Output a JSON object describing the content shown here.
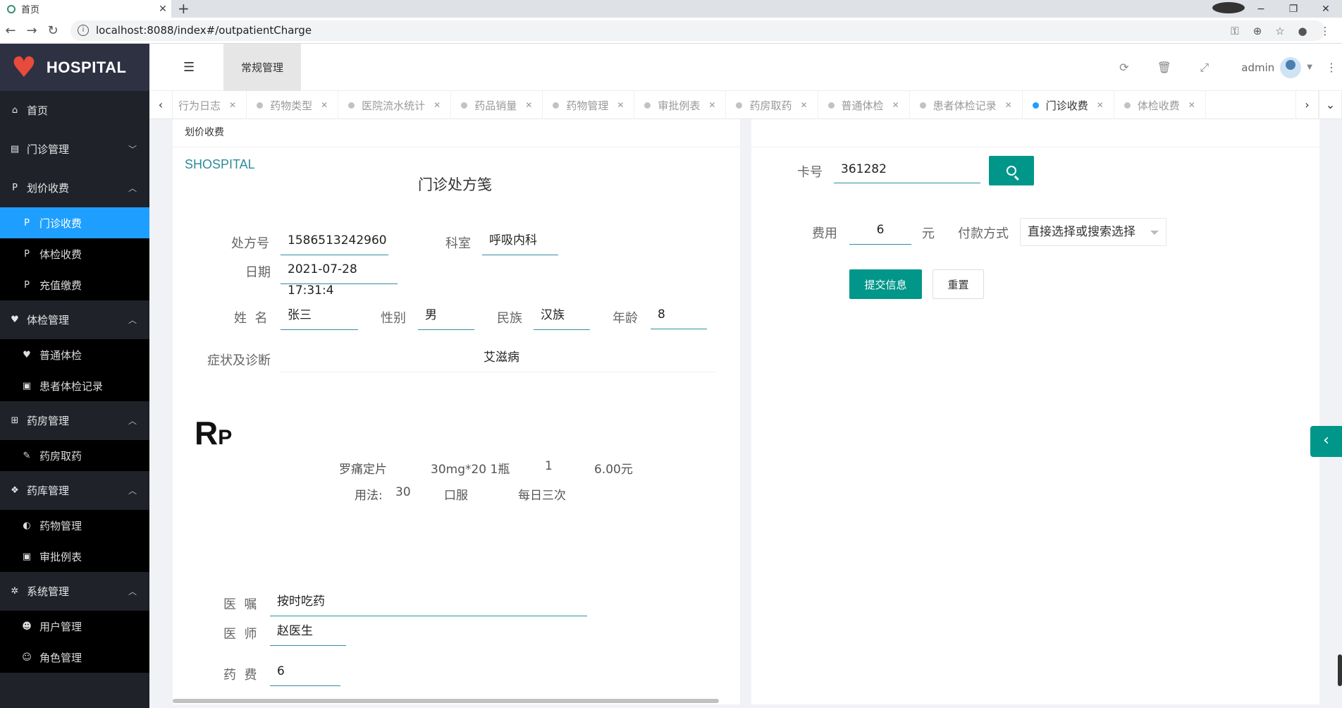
{
  "browser": {
    "tab_title": "首页",
    "tab_close": "✕",
    "new_tab": "+",
    "url": "localhost:8088/index#/outpatientCharge"
  },
  "sidebar": {
    "logo_text": "HOSPITAL",
    "items": [
      {
        "label": "首页"
      },
      {
        "label": "门诊管理"
      },
      {
        "label": "划价收费"
      },
      {
        "label": "门诊收费"
      },
      {
        "label": "体检收费"
      },
      {
        "label": "充值缴费"
      },
      {
        "label": "体检管理"
      },
      {
        "label": "普通体检"
      },
      {
        "label": "患者体检记录"
      },
      {
        "label": "药房管理"
      },
      {
        "label": "药房取药"
      },
      {
        "label": "药库管理"
      },
      {
        "label": "药物管理"
      },
      {
        "label": "审批例表"
      },
      {
        "label": "系统管理"
      },
      {
        "label": "用户管理"
      },
      {
        "label": "角色管理"
      }
    ]
  },
  "header": {
    "tab_label": "常规管理",
    "user": "admin"
  },
  "page_tabs": [
    {
      "label": "行为日志"
    },
    {
      "label": "药物类型"
    },
    {
      "label": "医院流水统计"
    },
    {
      "label": "药品销量"
    },
    {
      "label": "药物管理"
    },
    {
      "label": "审批例表"
    },
    {
      "label": "药房取药"
    },
    {
      "label": "普通体检"
    },
    {
      "label": "患者体检记录"
    },
    {
      "label": "门诊收费"
    },
    {
      "label": "体检收费"
    }
  ],
  "prescription": {
    "card_title": "划价收费",
    "brand": "SHOSPITAL",
    "title": "门诊处方笺",
    "rx_no_label": "处方号",
    "rx_no": "1586513242960",
    "dept_label": "科室",
    "dept": "呼吸内科",
    "date_label": "日期",
    "date": "2021-07-28 17:31:4",
    "name_label": "姓  名",
    "name": "张三",
    "gender_label": "性别",
    "gender": "男",
    "ethnic_label": "民族",
    "ethnic": "汉族",
    "age_label": "年龄",
    "age": "8",
    "diag_label": "症状及诊断",
    "diag": "艾滋病",
    "rp": "R",
    "rp_sub": "P",
    "medicine": {
      "name": "罗痛定片",
      "spec": "30mg*20 1瓶",
      "qty": "1",
      "price": "6.00元",
      "usage_label": "用法:",
      "usage_amount": "30",
      "route": "口服",
      "freq": "每日三次"
    },
    "advice_label": "医  嘱",
    "advice": "按时吃药",
    "doctor_label": "医  师",
    "doctor": "赵医生",
    "fee_label": "药  费",
    "fee": "6"
  },
  "payment": {
    "card_label": "卡号",
    "card_no": "361282",
    "fee_label": "费用",
    "fee": "6",
    "unit": "元",
    "method_label": "付款方式",
    "method_placeholder": "直接选择或搜索选择",
    "submit": "提交信息",
    "reset": "重置"
  },
  "colors": {
    "sidebar_bg": "#20222a",
    "active_blue": "#1e9fff",
    "teal": "#00968a",
    "logo_red": "#e84a3c"
  }
}
